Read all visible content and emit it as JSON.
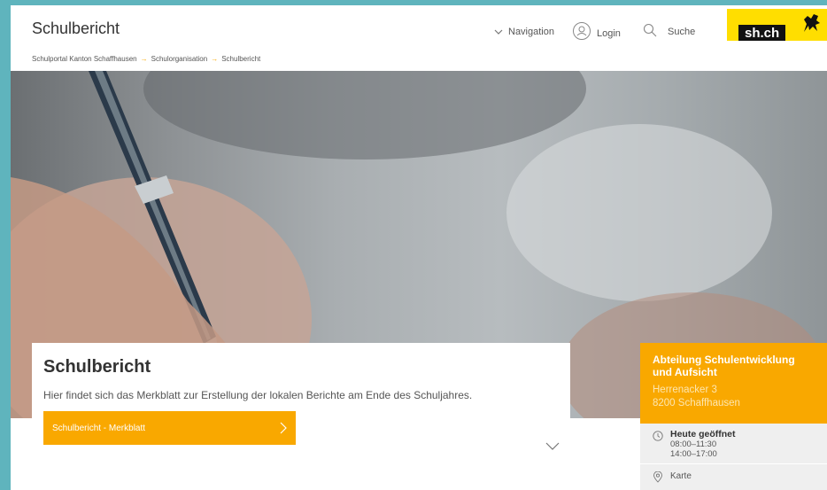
{
  "header": {
    "site_title": "Schulbericht",
    "nav_label": "Navigation",
    "login_label": "Login",
    "search_label": "Suche",
    "logo_text": "sh.ch"
  },
  "breadcrumb": {
    "items": [
      "Schulportal Kanton Schaffhausen",
      "Schulorganisation",
      "Schulbericht"
    ]
  },
  "content": {
    "title": "Schulbericht",
    "description": "Hier findet sich das Merkblatt zur Erstellung der lokalen Berichte am Ende des Schuljahres.",
    "button_label": "Schulbericht - Merkblatt"
  },
  "sidebar": {
    "title": "Abteilung Schulentwicklung und Aufsicht",
    "address_line1": "Herrenacker 3",
    "address_line2": "8200 Schaffhausen",
    "open_label": "Heute geöffnet",
    "hours1": "08:00–11:30",
    "hours2": "14:00–17:00",
    "map_label": "Karte"
  },
  "colors": {
    "accent": "#f9a800",
    "logo_yellow": "#ffde00",
    "frame": "#5fb4bd"
  }
}
